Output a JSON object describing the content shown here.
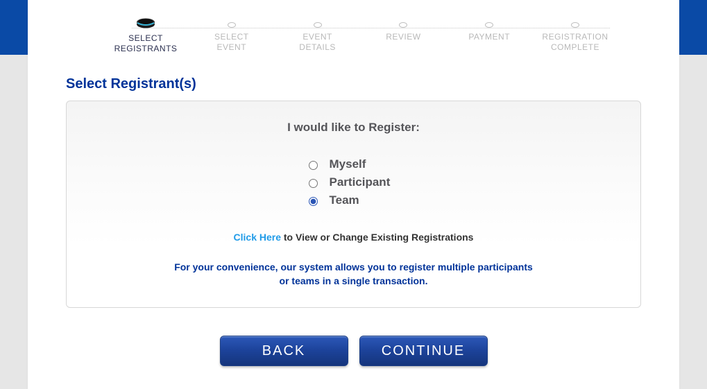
{
  "stepper": {
    "steps": [
      {
        "line1": "SELECT",
        "line2": "REGISTRANTS",
        "active": true
      },
      {
        "line1": "SELECT",
        "line2": "EVENT",
        "active": false
      },
      {
        "line1": "EVENT",
        "line2": "DETAILS",
        "active": false
      },
      {
        "line1": "REVIEW",
        "line2": "",
        "active": false
      },
      {
        "line1": "PAYMENT",
        "line2": "",
        "active": false
      },
      {
        "line1": "REGISTRATION",
        "line2": "COMPLETE",
        "active": false
      }
    ]
  },
  "heading": "Select Registrant(s)",
  "prompt": "I would like to Register:",
  "options": [
    {
      "label": "Myself",
      "selected": false
    },
    {
      "label": "Participant",
      "selected": false
    },
    {
      "label": "Team",
      "selected": true
    }
  ],
  "existing_link": {
    "link_text": "Click Here",
    "tail": " to View or Change Existing Registrations"
  },
  "help_note_line1": "For your convenience, our system allows you to register multiple participants",
  "help_note_line2": "or teams in a single transaction.",
  "buttons": {
    "back": "BACK",
    "continue": "CONTINUE"
  }
}
